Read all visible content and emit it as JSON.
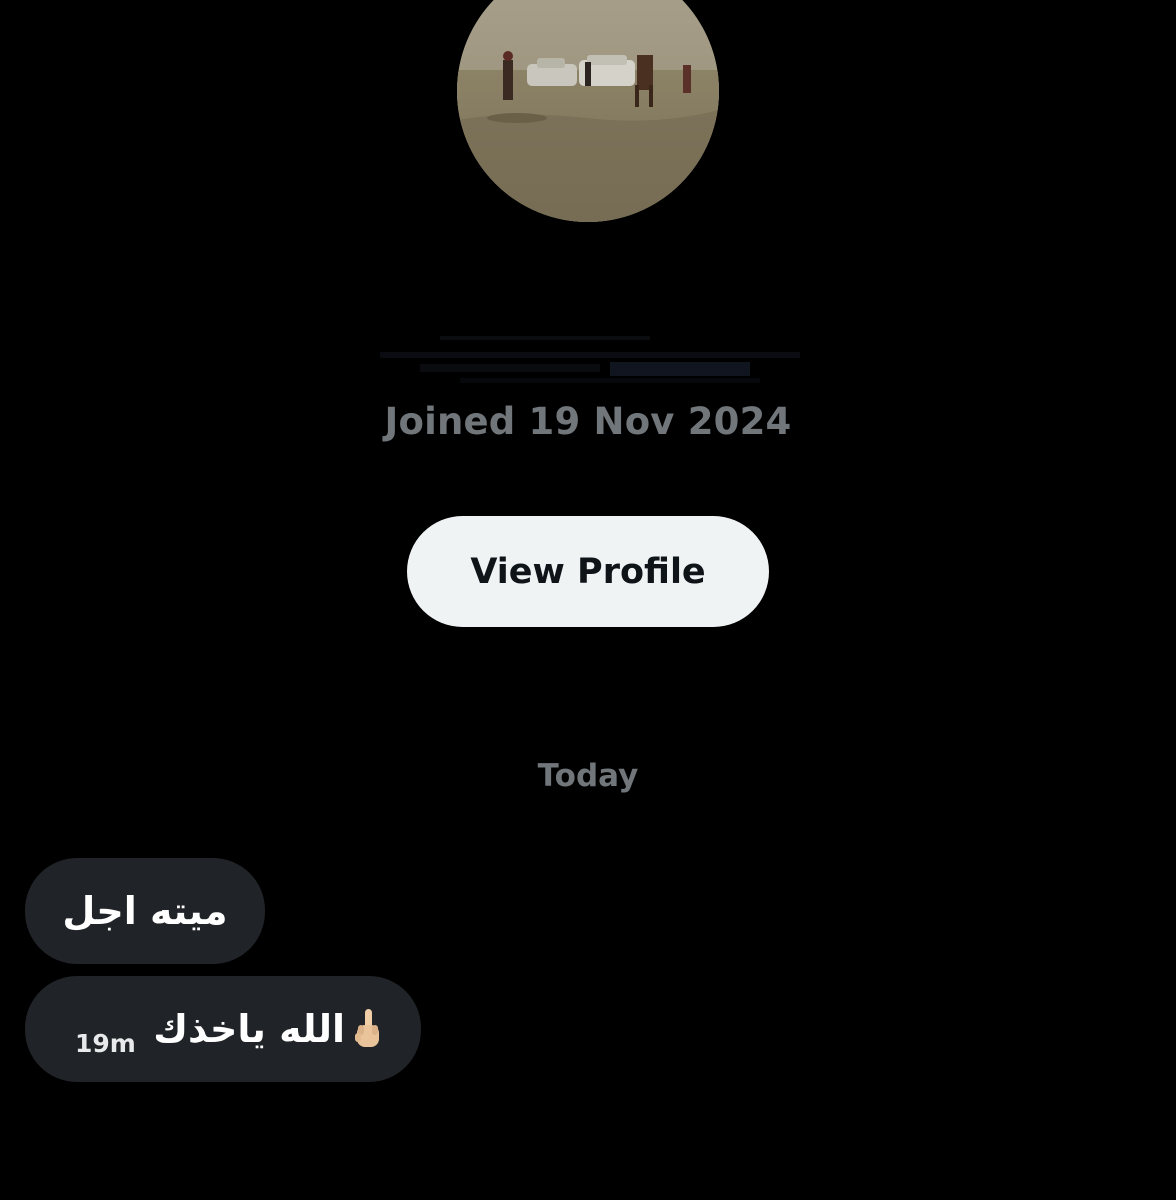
{
  "profile": {
    "avatar_icon": "avatar-photo-icon",
    "joined_text": "Joined 19 Nov 2024",
    "view_profile_label": "View Profile"
  },
  "conversation": {
    "day_separator": "Today",
    "messages": [
      {
        "text": "ميته اجل"
      },
      {
        "text": "الله ياخذك",
        "emoji": "middle-finger-emoji-icon",
        "time": "19m"
      }
    ]
  },
  "colors": {
    "background": "#000000",
    "bubble": "#202327",
    "muted_text": "#71767b",
    "button_bg": "#eff3f4",
    "button_text": "#0f1419"
  }
}
